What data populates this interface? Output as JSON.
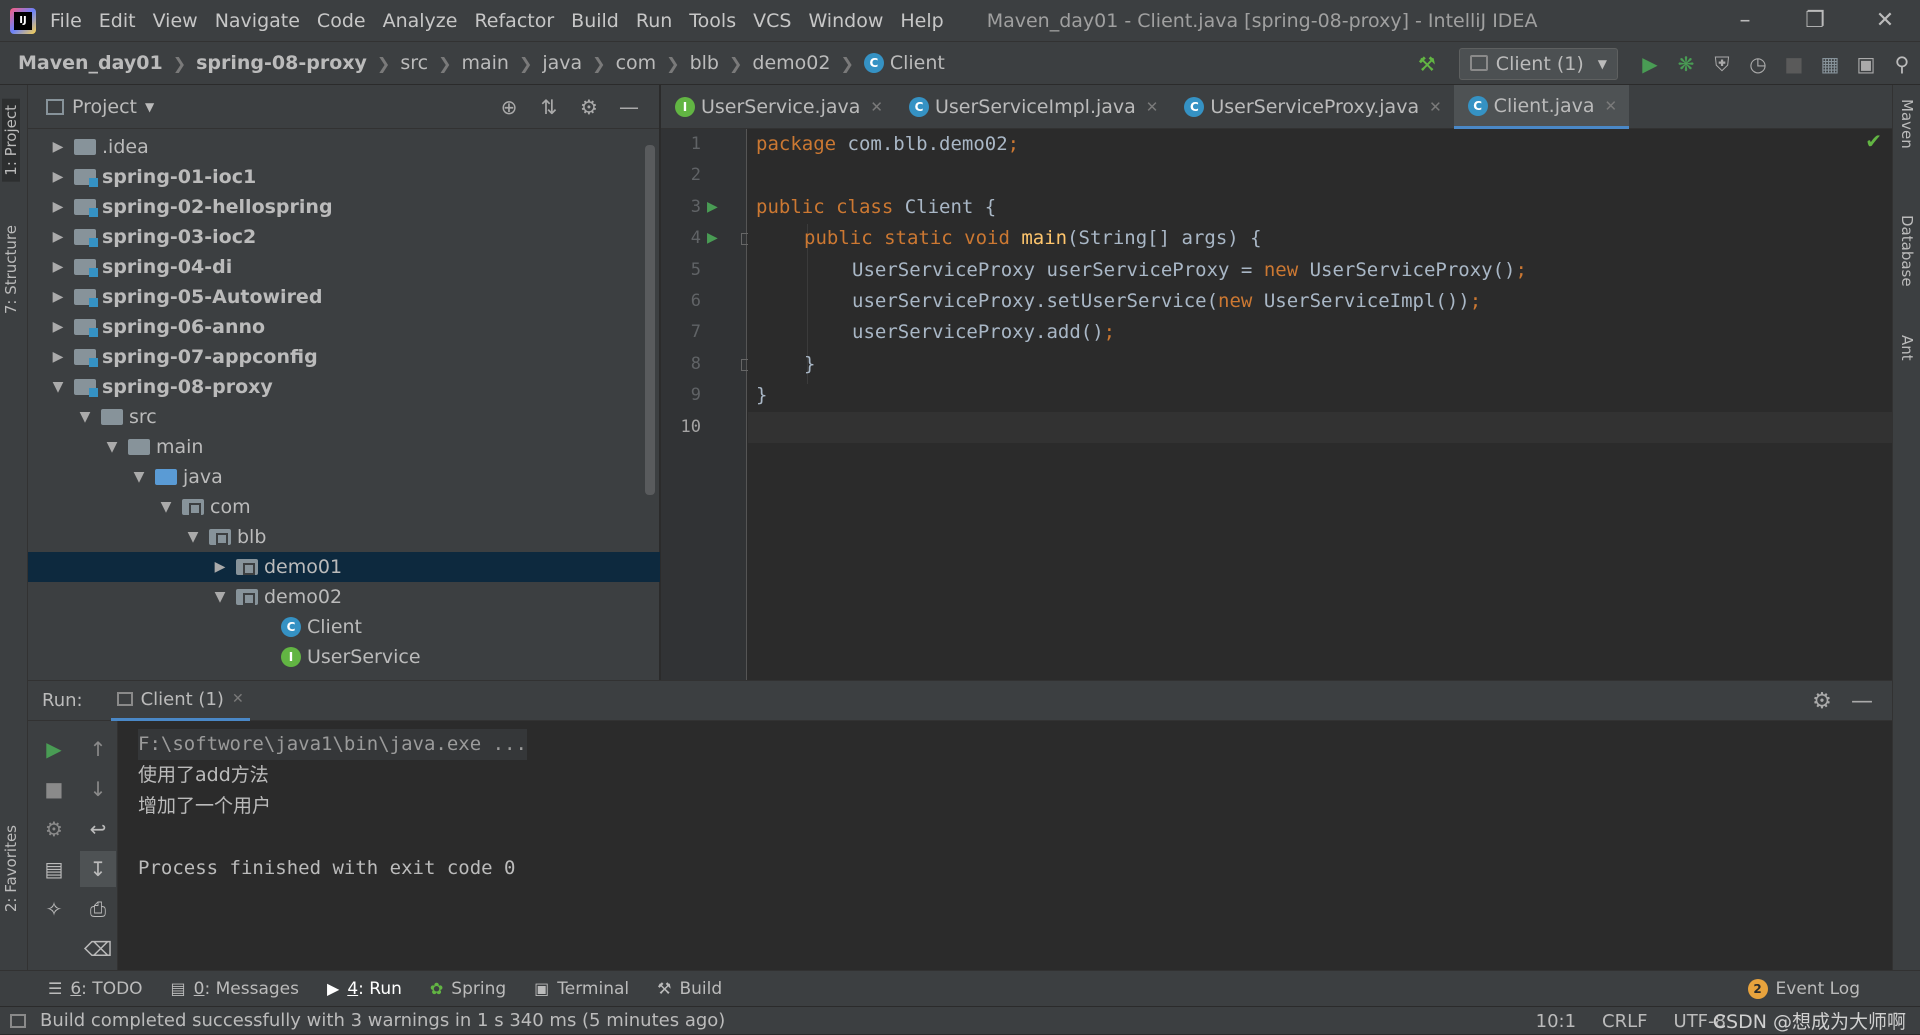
{
  "menubar": {
    "logo": "IJ",
    "items": [
      "File",
      "Edit",
      "View",
      "Navigate",
      "Code",
      "Analyze",
      "Refactor",
      "Build",
      "Run",
      "Tools",
      "VCS",
      "Window",
      "Help"
    ],
    "window_title": "Maven_day01 - Client.java [spring-08-proxy] - IntelliJ IDEA"
  },
  "breadcrumbs": [
    "Maven_day01",
    "spring-08-proxy",
    "src",
    "main",
    "java",
    "com",
    "blb",
    "demo02",
    "Client"
  ],
  "toolbar": {
    "run_config": "Client (1)"
  },
  "left_tabs": [
    "1: Project",
    "7: Structure",
    "2: Favorites"
  ],
  "right_tabs": [
    "Maven",
    "Database",
    "Ant"
  ],
  "project": {
    "title": "Project",
    "tree": [
      {
        "label": ".idea",
        "bold": false
      },
      {
        "label": "spring-01-ioc1",
        "bold": true
      },
      {
        "label": "spring-02-hellospring",
        "bold": true
      },
      {
        "label": "spring-03-ioc2",
        "bold": true
      },
      {
        "label": "spring-04-di",
        "bold": true
      },
      {
        "label": "spring-05-Autowired",
        "bold": true
      },
      {
        "label": "spring-06-anno",
        "bold": true
      },
      {
        "label": "spring-07-appconfig",
        "bold": true
      },
      {
        "label": "spring-08-proxy",
        "bold": true
      },
      {
        "label": "src",
        "bold": false
      },
      {
        "label": "main",
        "bold": false
      },
      {
        "label": "java",
        "bold": false
      },
      {
        "label": "com",
        "bold": false
      },
      {
        "label": "blb",
        "bold": false
      },
      {
        "label": "demo01",
        "bold": false
      },
      {
        "label": "demo02",
        "bold": false
      },
      {
        "label": "Client",
        "bold": false
      },
      {
        "label": "UserService",
        "bold": false
      }
    ]
  },
  "editor": {
    "tabs": [
      {
        "label": "UserService.java",
        "icon": "I"
      },
      {
        "label": "UserServiceImpl.java",
        "icon": "C"
      },
      {
        "label": "UserServiceProxy.java",
        "icon": "C"
      },
      {
        "label": "Client.java",
        "icon": "C"
      }
    ],
    "line_numbers": [
      "1",
      "2",
      "3",
      "4",
      "5",
      "6",
      "7",
      "8",
      "9",
      "10"
    ],
    "code": {
      "l1_kw": "package",
      "l1_rest": " com.blb.demo02",
      "l1_semi": ";",
      "l3_kw": "public class",
      "l3_rest": " Client {",
      "l4_kw": "public static void",
      "l4_fn": " main",
      "l4_rest": "(String[] args) {",
      "l5_a": "UserServiceProxy userServiceProxy = ",
      "l5_kw": "new",
      "l5_b": " UserServiceProxy()",
      "l5_semi": ";",
      "l6_a": "userServiceProxy.setUserService(",
      "l6_kw": "new",
      "l6_b": " UserServiceImpl())",
      "l6_semi": ";",
      "l7_a": "userServiceProxy.add()",
      "l7_semi": ";",
      "l8": "}",
      "l9": "}"
    }
  },
  "run": {
    "label": "Run:",
    "tab": "Client (1)",
    "console": {
      "cmd": "F:\\softwore\\java1\\bin\\java.exe ...",
      "line1": "使用了add方法",
      "line2": "增加了一个用户",
      "line3": "Process finished with exit code 0"
    }
  },
  "tool_windows": [
    {
      "num": "6",
      "label": ": TODO"
    },
    {
      "num": "0",
      "label": ": Messages"
    },
    {
      "num": "4",
      "label": ": Run"
    },
    {
      "num": "",
      "label": "Spring"
    },
    {
      "num": "",
      "label": "Terminal"
    },
    {
      "num": "",
      "label": "Build"
    }
  ],
  "event_log": {
    "count": "2",
    "label": "Event Log"
  },
  "status": {
    "message": "Build completed successfully with 3 warnings in 1 s 340 ms (5 minutes ago)",
    "position": "10:1",
    "line_sep": "CRLF",
    "encoding": "UTF-8",
    "watermark": "CSDN @想成为大师啊"
  }
}
